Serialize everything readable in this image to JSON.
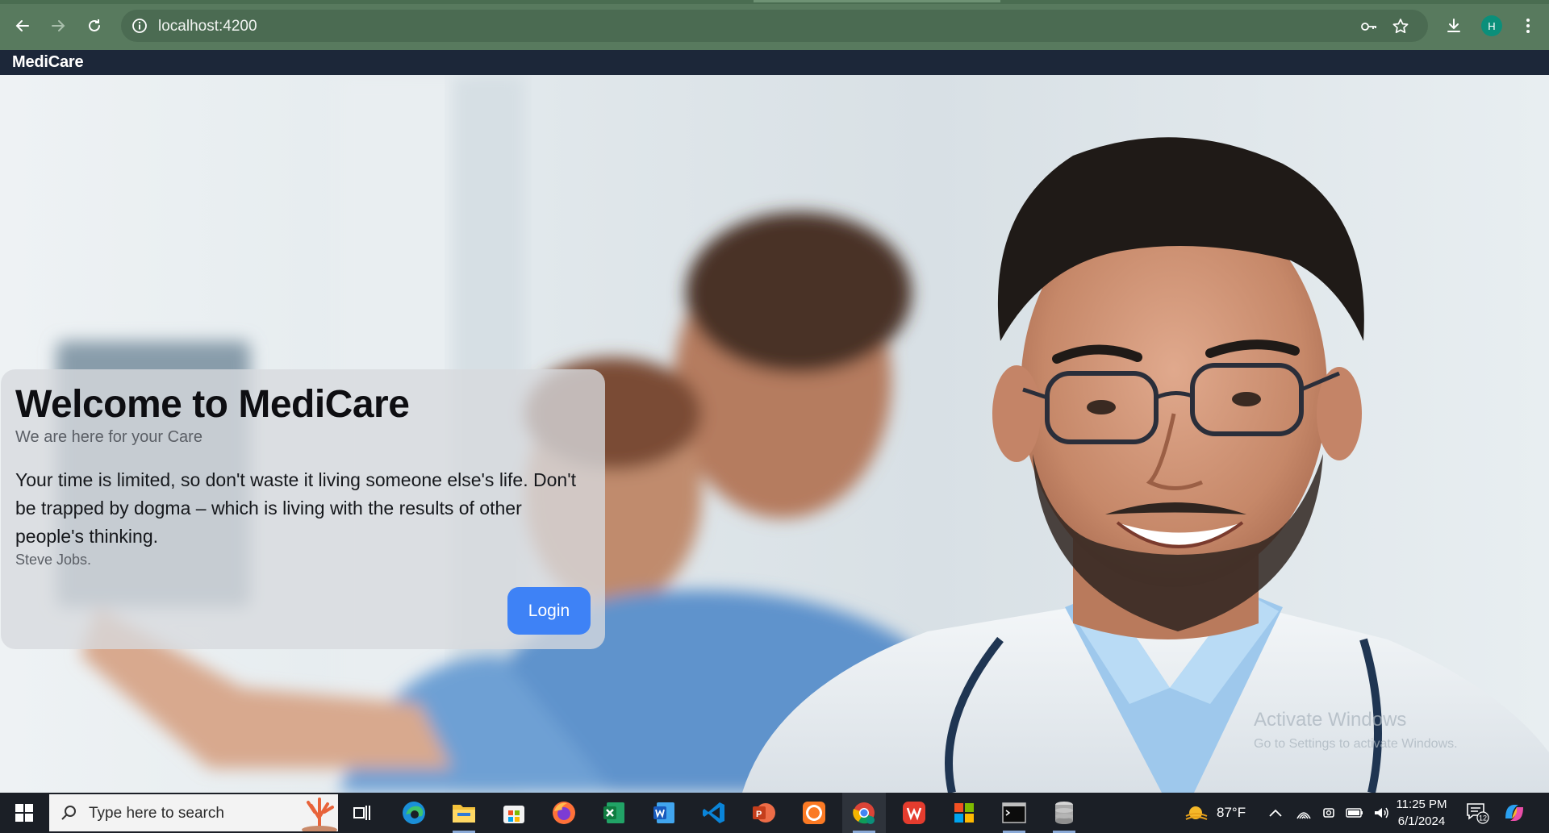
{
  "browser": {
    "url": "localhost:4200",
    "profile_initial": "H",
    "icons": [
      "back-icon",
      "forward-icon",
      "reload-icon",
      "site-info-icon",
      "password-key-icon",
      "bookmark-star-icon",
      "download-icon",
      "profile-avatar",
      "kebab-menu-icon"
    ]
  },
  "app": {
    "brand": "MediCare"
  },
  "hero": {
    "title": "Welcome to MediCare",
    "subtitle": "We are here for your Care",
    "quote": "Your time is limited, so don't waste it living someone else's life. Don't be trapped by dogma – which is living with the results of other people's thinking.",
    "author": "Steve Jobs.",
    "login_label": "Login"
  },
  "watermark": {
    "line1": "Activate Windows",
    "line2": "Go to Settings to activate Windows."
  },
  "taskbar": {
    "search_placeholder": "Type here to search",
    "apps": [
      "task-view",
      "edge",
      "file-explorer",
      "microsoft-store",
      "firefox",
      "excel",
      "word",
      "vscode",
      "powerpoint",
      "xampp",
      "chrome",
      "wps-office",
      "ms-office",
      "terminal",
      "database"
    ],
    "weather": "87°F",
    "time": "11:25 PM",
    "date": "6/1/2024",
    "notifications": "12"
  },
  "colors": {
    "chrome_bar": "#587a5e",
    "app_navbar": "#1c2739",
    "login_button": "#3e82f6",
    "taskbar": "#1b1f26"
  }
}
